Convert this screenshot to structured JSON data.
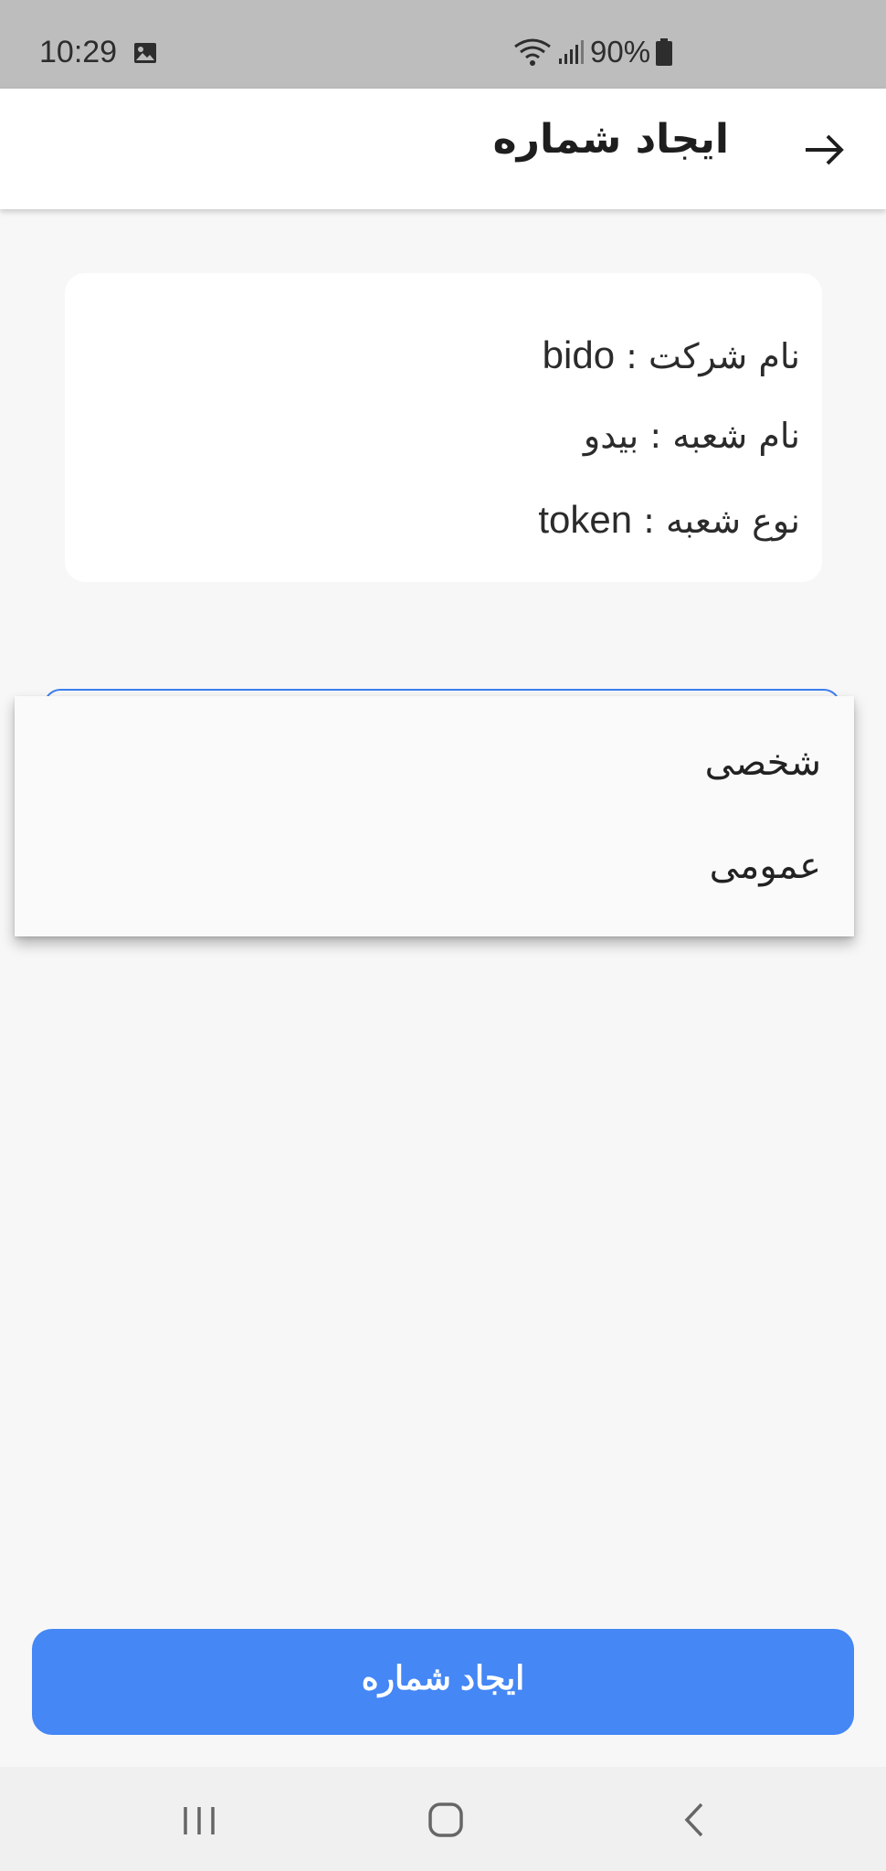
{
  "status_bar": {
    "time": "10:29",
    "battery": "90%",
    "icons": [
      "gallery-icon",
      "wifi-icon",
      "signal-icon",
      "battery-icon"
    ]
  },
  "app_bar": {
    "title": "ایجاد شماره",
    "back_icon": "arrow-right-icon"
  },
  "info_card": {
    "company_label": "نام شرکت : ",
    "company_value": "bido",
    "branch_label": "نام شعبه : ",
    "branch_value": "بیدو",
    "branch_type_label": "نوع شعبه : ",
    "branch_type_value": "token"
  },
  "dropdown": {
    "options": [
      "شخصی",
      "عمومی"
    ]
  },
  "primary_button": {
    "label": "ایجاد شماره"
  },
  "colors": {
    "accent": "#4487f5",
    "status_bar": "#bdbdbd",
    "background": "#f7f7f7"
  },
  "nav_bar": {
    "icons": [
      "recents-icon",
      "home-icon",
      "back-icon"
    ]
  }
}
